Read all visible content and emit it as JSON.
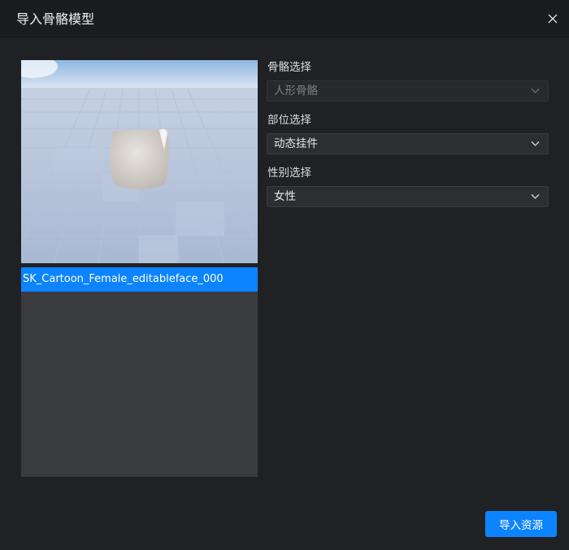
{
  "dialog": {
    "title": "导入骨骼模型",
    "close_icon": "close-icon"
  },
  "preview": {
    "model_list": [
      "SK_Cartoon_Female_editableface_000"
    ]
  },
  "fields": {
    "skeleton": {
      "label": "骨骼选择",
      "value": "人形骨骼",
      "disabled": true
    },
    "part": {
      "label": "部位选择",
      "value": "动态挂件"
    },
    "gender": {
      "label": "性别选择",
      "value": "女性"
    }
  },
  "footer": {
    "import_label": "导入资源"
  },
  "colors": {
    "accent": "#0c84ff",
    "background": "#202124",
    "titlebar": "#1b1c1f",
    "list_bg": "#3a3b3e"
  }
}
